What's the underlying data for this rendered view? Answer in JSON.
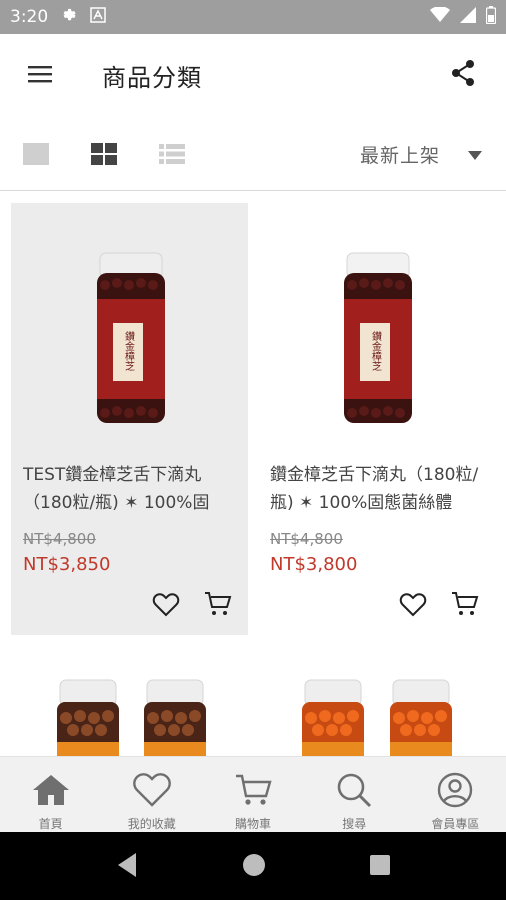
{
  "status_bar": {
    "time": "3:20"
  },
  "app_bar": {
    "title": "商品分類"
  },
  "toolbar": {
    "sort_label": "最新上架"
  },
  "products": [
    {
      "name": "TEST鑽金樟芝舌下滴丸（180粒/瓶) ✶ 100%固態…",
      "old_price": "NT$4,800",
      "price": "NT$3,850",
      "bottle_label": "鑽金樟芝"
    },
    {
      "name": "鑽金樟芝舌下滴丸（180粒/瓶) ✶ 100%固態菌絲體",
      "old_price": "NT$4,800",
      "price": "NT$3,800",
      "bottle_label": "鑽金樟芝"
    }
  ],
  "bottom_nav": [
    {
      "label": "首頁",
      "icon": "home-icon"
    },
    {
      "label": "我的收藏",
      "icon": "heart-icon"
    },
    {
      "label": "購物車",
      "icon": "cart-icon"
    },
    {
      "label": "搜尋",
      "icon": "search-icon"
    },
    {
      "label": "會員專區",
      "icon": "user-icon"
    }
  ],
  "colors": {
    "accent_price": "#c0392b",
    "status_bar": "#9e9e9e",
    "bottle_red": "#a11f1c",
    "bottle_orange": "#e88a1e"
  }
}
